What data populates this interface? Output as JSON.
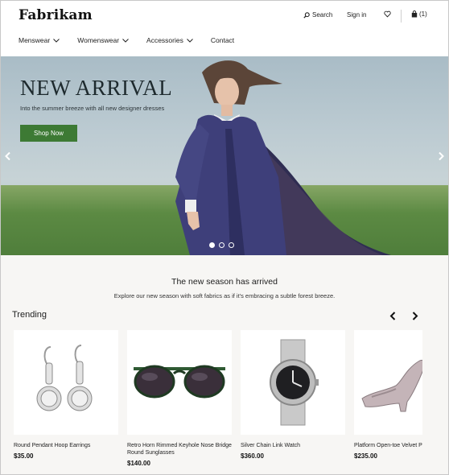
{
  "brand": {
    "name": "Fabrikam"
  },
  "header": {
    "search_label": "Search",
    "signin_label": "Sign in",
    "cart_count": "(1)"
  },
  "nav": [
    {
      "label": "Menswear",
      "has_dropdown": true
    },
    {
      "label": "Womenswear",
      "has_dropdown": true
    },
    {
      "label": "Accessories",
      "has_dropdown": true
    },
    {
      "label": "Contact",
      "has_dropdown": false
    }
  ],
  "hero": {
    "title": "NEW ARRIVAL",
    "subtitle": "Into the summer breeze with all new designer dresses",
    "cta": "Shop Now",
    "slides": 3,
    "active_slide": 1,
    "accent": "#3d7a34"
  },
  "season": {
    "title": "The new season has arrived",
    "description": "Explore our new season with soft fabrics as if it's embracing a subtle forest breeze."
  },
  "trending": {
    "heading": "Trending",
    "products": [
      {
        "name": "Round Pendant Hoop Earrings",
        "price": "$35.00",
        "icon": "earrings-icon"
      },
      {
        "name": "Retro Horn Rimmed Keyhole Nose Bridge Round Sunglasses",
        "price": "$140.00",
        "icon": "sunglasses-icon"
      },
      {
        "name": "Silver Chain Link Watch",
        "price": "$360.00",
        "icon": "watch-icon"
      },
      {
        "name": "Platform Open-toe Velvet Pump",
        "price": "$235.00",
        "icon": "shoe-icon"
      }
    ]
  }
}
